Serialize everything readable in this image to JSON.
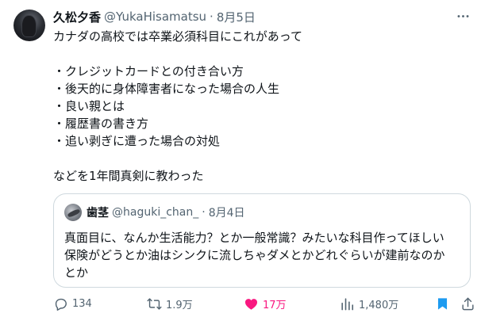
{
  "tweet": {
    "display_name": "久松夕香",
    "handle": "@YukaHisamatsu",
    "separator": "·",
    "date": "8月5日",
    "lines": [
      "カナダの高校では卒業必須科目にこれがあって",
      "",
      "・クレジットカードとの付き合い方",
      "・後天的に身体障害者になった場合の人生",
      "・良い親とは",
      "・履歴書の書き方",
      "・追い剥ぎに遭った場合の対処",
      "",
      "などを1年間真剣に教わった"
    ]
  },
  "quote": {
    "display_name": "歯茎",
    "handle": "@haguki_chan_",
    "separator": "·",
    "date": "8月4日",
    "lines": [
      "真面目に、なんか生活能力？とか一般常識？みたいな科目作ってほしい",
      "保険がどうとか油はシンクに流しちゃダメとかどれぐらいが建前なのか",
      "とか"
    ]
  },
  "actions": {
    "reply_count": "134",
    "retweet_count": "1.9万",
    "like_count": "17万",
    "views_count": "1,480万"
  },
  "icons": {
    "more": "more-icon",
    "reply": "reply-icon",
    "retweet": "retweet-icon",
    "like": "heart-icon",
    "views": "views-icon",
    "bookmark": "bookmark-icon",
    "share": "share-icon"
  },
  "colors": {
    "text": "#0f1419",
    "secondary": "#536471",
    "border": "#cfd9de",
    "like": "#f91880",
    "bookmark": "#1d9bf0"
  }
}
